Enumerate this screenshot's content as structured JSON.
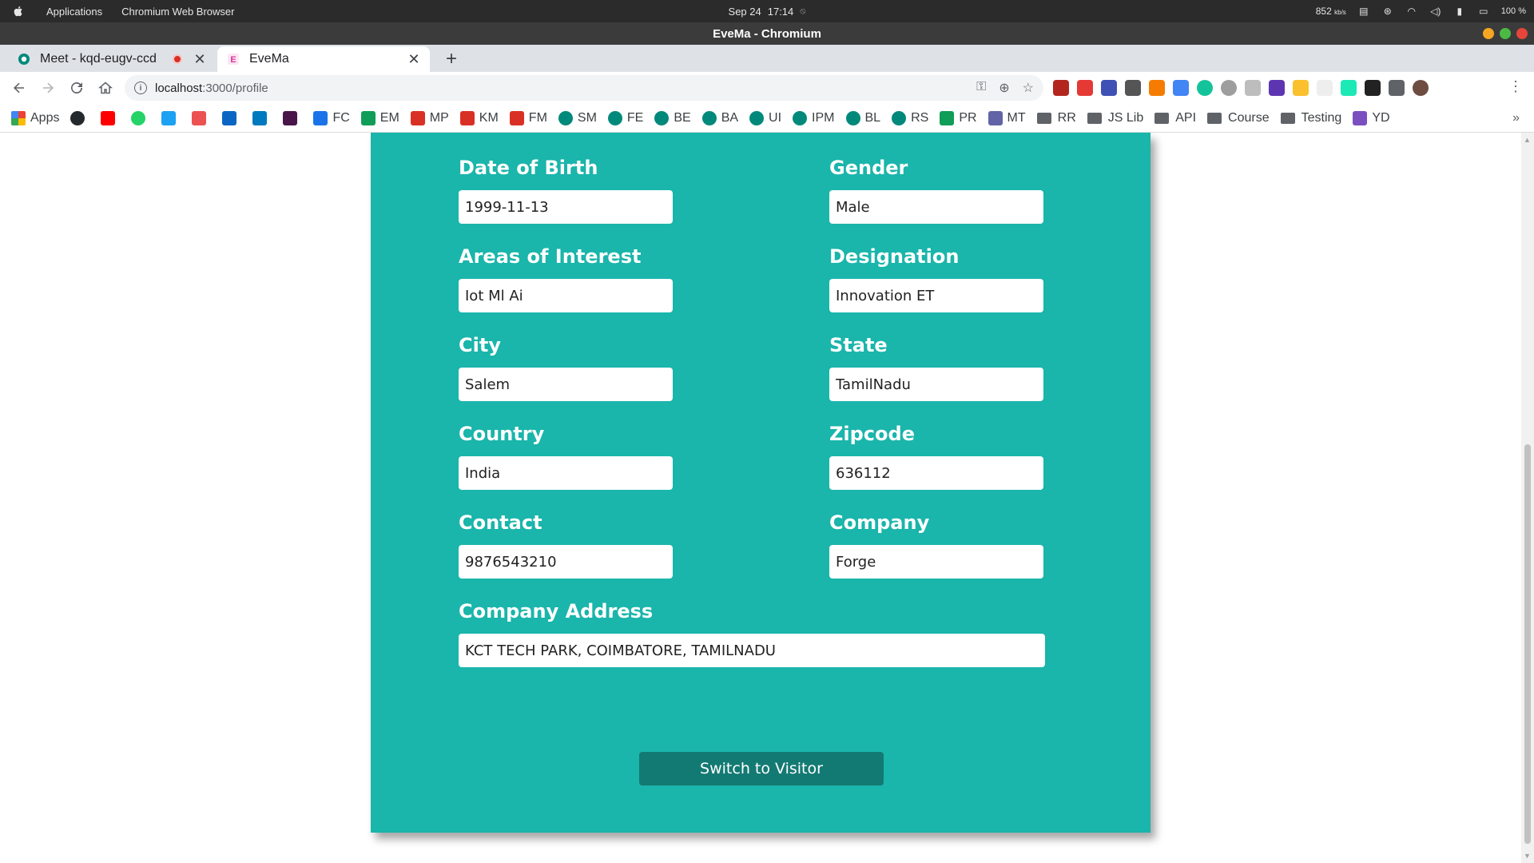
{
  "os_bar": {
    "menus": [
      "Applications",
      "Chromium Web Browser"
    ],
    "date": "Sep 24",
    "time": "17:14",
    "net_speed": "852",
    "net_unit": "kb/s",
    "battery": "100 %"
  },
  "window": {
    "title": "EveMa - Chromium"
  },
  "tabs": [
    {
      "label": "Meet - kqd-eugv-ccd",
      "favicon": "google-meet-icon",
      "recording": true
    },
    {
      "label": "EveMa",
      "favicon": "evema-icon",
      "recording": false
    }
  ],
  "address": {
    "host": "localhost",
    "path": ":3000/profile"
  },
  "bookmarks": {
    "apps_label": "Apps",
    "labeled": [
      {
        "label": "FC",
        "icon": "calendar-icon",
        "color": "#1a73e8"
      },
      {
        "label": "EM",
        "icon": "drive-icon",
        "color": "#0f9d58"
      },
      {
        "label": "MP",
        "icon": "gmail-icon",
        "color": "#d93025"
      },
      {
        "label": "KM",
        "icon": "gmail-icon",
        "color": "#d93025"
      },
      {
        "label": "FM",
        "icon": "gmail-icon",
        "color": "#d93025"
      },
      {
        "label": "SM",
        "icon": "meet-icon",
        "color": "#00897b"
      },
      {
        "label": "FE",
        "icon": "meet-icon",
        "color": "#00897b"
      },
      {
        "label": "BE",
        "icon": "meet-icon",
        "color": "#00897b"
      },
      {
        "label": "BA",
        "icon": "meet-icon",
        "color": "#00897b"
      },
      {
        "label": "UI",
        "icon": "meet-icon",
        "color": "#00897b"
      },
      {
        "label": "IPM",
        "icon": "meet-icon",
        "color": "#00897b"
      },
      {
        "label": "BL",
        "icon": "meet-icon",
        "color": "#00897b"
      },
      {
        "label": "RS",
        "icon": "meet-icon",
        "color": "#00897b"
      },
      {
        "label": "PR",
        "icon": "sheets-icon",
        "color": "#0f9d58"
      },
      {
        "label": "MT",
        "icon": "teams-icon",
        "color": "#6264a7"
      },
      {
        "label": "RR",
        "icon": "folder-icon",
        "color": "#5f6368"
      },
      {
        "label": "JS Lib",
        "icon": "folder-icon",
        "color": "#5f6368"
      },
      {
        "label": "API",
        "icon": "folder-icon",
        "color": "#5f6368"
      },
      {
        "label": "Course",
        "icon": "folder-icon",
        "color": "#5f6368"
      },
      {
        "label": "Testing",
        "icon": "folder-icon",
        "color": "#5f6368"
      },
      {
        "label": "YD",
        "icon": "vs-icon",
        "color": "#7b4fbf"
      }
    ],
    "more": "»"
  },
  "profile": {
    "date_of_birth": {
      "label": "Date of Birth",
      "value": "1999-11-13"
    },
    "gender": {
      "label": "Gender",
      "value": "Male"
    },
    "areas_of_interest": {
      "label": "Areas of Interest",
      "value": "Iot Ml Ai"
    },
    "designation": {
      "label": "Designation",
      "value": "Innovation ET"
    },
    "city": {
      "label": "City",
      "value": "Salem"
    },
    "state": {
      "label": "State",
      "value": "TamilNadu"
    },
    "country": {
      "label": "Country",
      "value": "India"
    },
    "zipcode": {
      "label": "Zipcode",
      "value": "636112"
    },
    "contact": {
      "label": "Contact",
      "value": "9876543210"
    },
    "company": {
      "label": "Company",
      "value": "Forge"
    },
    "company_address": {
      "label": "Company Address",
      "value": "KCT TECH PARK, COIMBATORE, TAMILNADU"
    },
    "switch_button": "Switch to Visitor"
  },
  "colors": {
    "card": "#1ab5ab",
    "button": "#137a73"
  }
}
